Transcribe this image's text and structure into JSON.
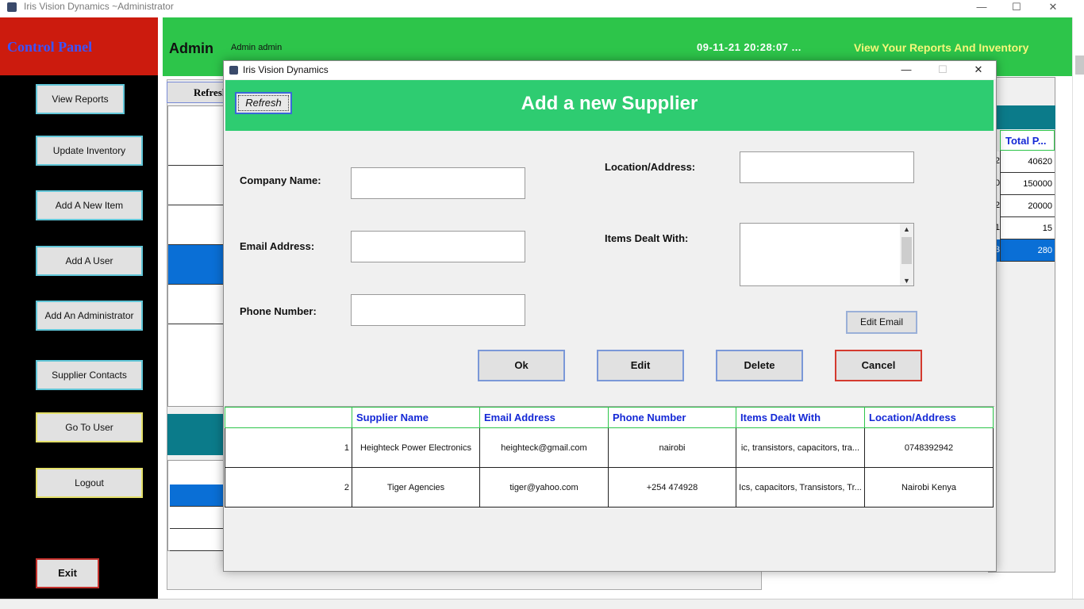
{
  "window": {
    "title": "Iris Vision Dynamics ~Administrator",
    "minimize": "—",
    "maximize": "☐",
    "close": "✕"
  },
  "control_panel": {
    "title": "Control Panel",
    "buttons": [
      {
        "label": "View Reports"
      },
      {
        "label": "Update Inventory"
      },
      {
        "label": "Add A New Item"
      },
      {
        "label": "Add A User"
      },
      {
        "label": "Add An Administrator"
      },
      {
        "label": "Supplier Contacts"
      },
      {
        "label": "Go To User"
      },
      {
        "label": "Logout"
      },
      {
        "label": "Exit"
      }
    ]
  },
  "header": {
    "role": "Admin",
    "user_name": "Admin admin",
    "datetime": "09-11-21  20:28:07   ...",
    "reports_link": "View Your Reports And Inventory"
  },
  "background": {
    "refresh_label": "Refresh",
    "right_table": {
      "header": "Total P...",
      "left_digits": [
        "2",
        "0",
        "2",
        "1",
        "3"
      ],
      "values": [
        "40620",
        "150000",
        "20000",
        "15",
        "280"
      ]
    }
  },
  "dialog": {
    "title": "Iris Vision Dynamics",
    "heading": "Add a new Supplier",
    "refresh_label": "Refresh",
    "fields": {
      "company_name_label": "Company Name:",
      "company_name_value": "",
      "email_label": "Email Address:",
      "email_value": "",
      "phone_label": "Phone Number:",
      "phone_value": "",
      "location_label": "Location/Address:",
      "location_value": "",
      "items_label": "Items Dealt With:",
      "items_value": ""
    },
    "edit_email_label": "Edit Email",
    "actions": {
      "ok": "Ok",
      "edit": "Edit",
      "delete": "Delete",
      "cancel": "Cancel"
    },
    "table": {
      "columns": [
        "",
        "Supplier Name",
        "Email Address",
        "Phone Number",
        "Items Dealt With",
        "Location/Address"
      ],
      "rows": [
        [
          "1",
          "Heighteck Power Electronics",
          "heighteck@gmail.com",
          "nairobi",
          "ic, transistors, capacitors, tra...",
          "0748392942"
        ],
        [
          "2",
          "Tiger Agencies",
          "tiger@yahoo.com",
          "+254 474928",
          "Ics, capacitors, Transistors, Tr...",
          "Nairobi Kenya"
        ]
      ]
    }
  },
  "colors": {
    "control_panel_header": "#cc1b0e",
    "control_panel_title": "#3a54ff",
    "header_green": "#2dc54a",
    "dialog_header_green": "#2ecc71",
    "table_header_text": "#1428d6",
    "selection_blue": "#0a6fd6",
    "teal": "#0b7b8a",
    "reports_link_yellow": "#f5f77a"
  }
}
